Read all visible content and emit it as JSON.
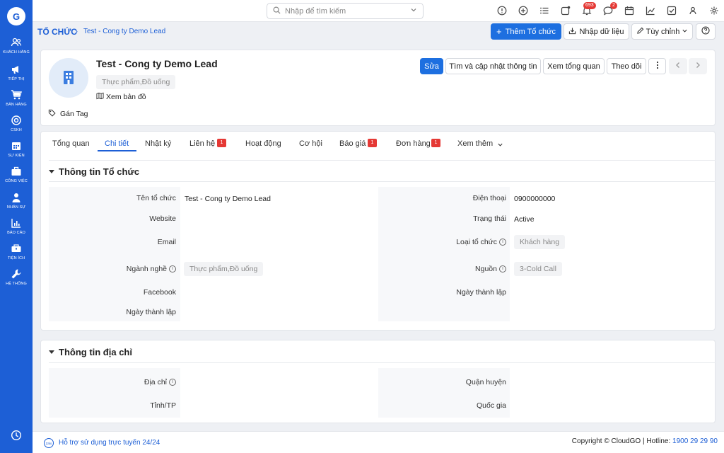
{
  "sidebar": {
    "items": [
      {
        "label": "Khách hàng"
      },
      {
        "label": "Tiếp thị"
      },
      {
        "label": "Bán hàng"
      },
      {
        "label": "CSKH"
      },
      {
        "label": "Sự kiện"
      },
      {
        "label": "Công việc"
      },
      {
        "label": "Nhân sự"
      },
      {
        "label": "Báo cáo"
      },
      {
        "label": "Tiện ích"
      },
      {
        "label": "Hệ thống"
      }
    ]
  },
  "topbar": {
    "search_placeholder": "Nhập để tìm kiếm",
    "notifications_badge": "693",
    "messages_badge": "2"
  },
  "breadcrumb": {
    "root": "TỔ CHỨC",
    "current": "Test - Cong ty Demo Lead"
  },
  "actions": {
    "add": "Thêm Tổ chức",
    "import": "Nhập dữ liệu",
    "customize": "Tùy chỉnh"
  },
  "header": {
    "name": "Test - Cong ty Demo Lead",
    "industry_chip": "Thực phẩm,Đồ uống",
    "map_link": "Xem bản đồ",
    "tag_link": "Gán Tag",
    "buttons": {
      "edit": "Sửa",
      "find_update": "Tìm và cập nhật thông tin",
      "overview": "Xem tổng quan",
      "follow": "Theo dõi"
    }
  },
  "tabs": [
    {
      "label": "Tổng quan"
    },
    {
      "label": "Chi tiết"
    },
    {
      "label": "Nhật ký"
    },
    {
      "label": "Liên hệ",
      "badge": "1"
    },
    {
      "label": "Hoạt động"
    },
    {
      "label": "Cơ hội"
    },
    {
      "label": "Báo giá",
      "badge": "1"
    },
    {
      "label": "Đơn hàng",
      "badge": "1"
    },
    {
      "label": "Xem thêm"
    }
  ],
  "org_section": {
    "title": "Thông tin Tổ chức",
    "left": [
      {
        "label": "Tên tổ chức",
        "value": "Test - Cong ty Demo Lead"
      },
      {
        "label": "Website",
        "value": ""
      },
      {
        "label": "Email",
        "value": ""
      },
      {
        "label": "Ngành nghề",
        "value": "Thực phẩm,Đồ uống"
      },
      {
        "label": "Facebook",
        "value": ""
      },
      {
        "label": "Ngày thành lập",
        "value": ""
      }
    ],
    "right": [
      {
        "label": "Điện thoại",
        "value": "0900000000"
      },
      {
        "label": "Trạng thái",
        "value": "Active"
      },
      {
        "label": "Loại tổ chức",
        "value": "Khách hàng"
      },
      {
        "label": "Nguồn",
        "value": "3-Cold Call"
      },
      {
        "label": "Ngày thành lập",
        "value": ""
      }
    ]
  },
  "address_section": {
    "title": "Thông tin địa chỉ",
    "left": [
      {
        "label": "Địa chỉ",
        "value": ""
      },
      {
        "label": "Tỉnh/TP",
        "value": ""
      }
    ],
    "right": [
      {
        "label": "Quận huyện",
        "value": ""
      },
      {
        "label": "Quốc gia",
        "value": ""
      }
    ]
  },
  "footer": {
    "zalo": "Zalo",
    "support": "Hỗ trợ sử dụng trực tuyến 24/24",
    "copyright": "Copyright © CloudGO",
    "hotline_label": "Hotline:",
    "hotline": "1900 29 29 90"
  },
  "colors": {
    "primary": "#1d5fd6",
    "badge": "#e53935"
  }
}
